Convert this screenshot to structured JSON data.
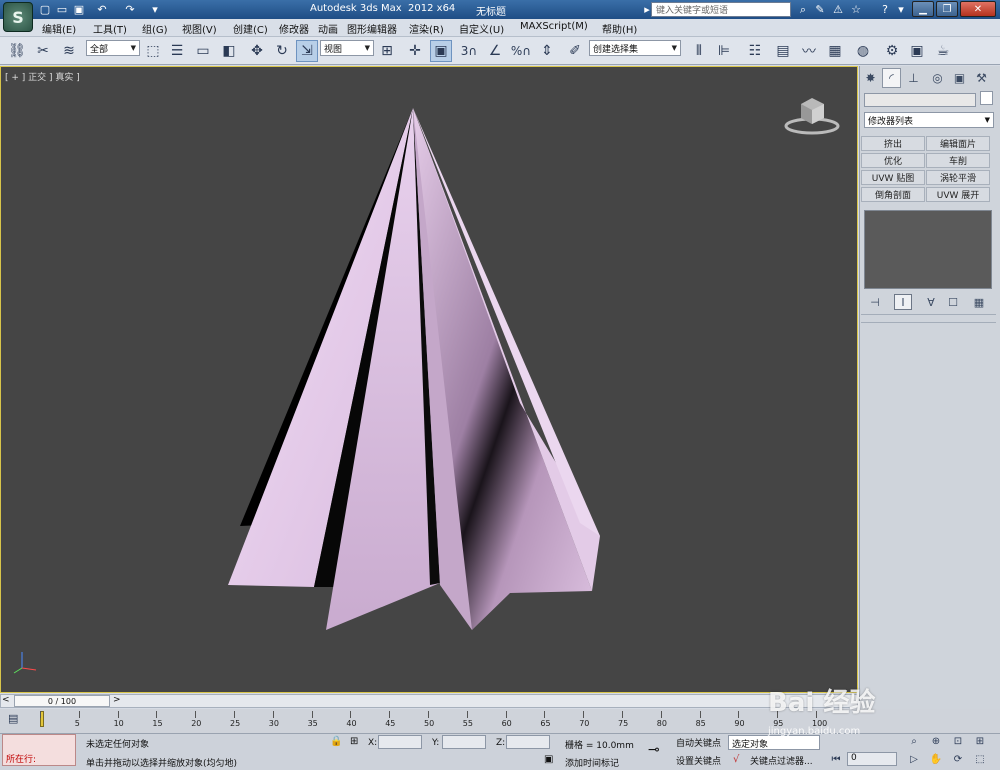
{
  "titlebar": {
    "app_title": "Autodesk 3ds Max  2012 x64",
    "doc_title": "无标题",
    "search_placeholder": "键入关键字或短语"
  },
  "menu": [
    "编辑(E)",
    "工具(T)",
    "组(G)",
    "视图(V)",
    "创建(C)",
    "修改器",
    "动画",
    "图形编辑器",
    "渲染(R)",
    "自定义(U)",
    "MAXScript(M)",
    "帮助(H)"
  ],
  "toolbar": {
    "selection_filter": "全部",
    "ref_coord": "视图",
    "named_selection": "创建选择集",
    "snap_labels": [
      "3",
      "%"
    ]
  },
  "viewport": {
    "label": "[ + ] 正交 ] 真实 ]"
  },
  "command_panel": {
    "modifier_list": "修改器列表",
    "modifier_buttons": [
      "挤出",
      "编辑面片",
      "优化",
      "车削",
      "UVW 贴图",
      "涡轮平滑",
      "倒角剖面",
      "UVW 展开"
    ]
  },
  "timeline": {
    "position": "0 / 100",
    "ticks": [
      "0",
      "5",
      "10",
      "15",
      "20",
      "25",
      "30",
      "35",
      "40",
      "45",
      "50",
      "55",
      "60",
      "65",
      "70",
      "75",
      "80",
      "85",
      "90",
      "95",
      "100"
    ]
  },
  "status": {
    "maxscript": "所在行:",
    "selection": "未选定任何对象",
    "prompt": "单击并拖动以选择并缩放对象(均匀地)",
    "x_label": "X:",
    "y_label": "Y:",
    "z_label": "Z:",
    "grid": "栅格 = 10.0mm",
    "add_time_tag": "添加时间标记",
    "auto_key": "自动关键点",
    "set_key": "设置关键点",
    "selected_set": "选定对象",
    "key_filters": "关键点过滤器...",
    "frame": "0"
  },
  "watermark": {
    "brand": "Bai 经验",
    "url": "jingyan.baidu.com"
  },
  "colors": {
    "viewport_bg": "#454545",
    "object_color": "#e4c8e8",
    "viewport_border": "#d7c44a"
  }
}
